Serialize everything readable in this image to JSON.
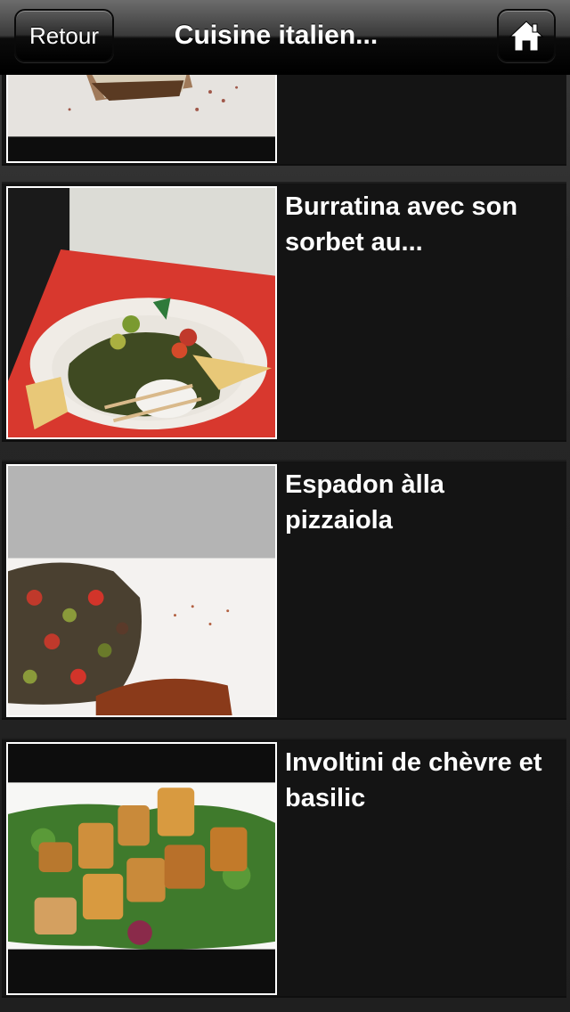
{
  "navbar": {
    "back_label": "Retour",
    "title": "Cuisine italien..."
  },
  "items": [
    {
      "title": "",
      "photo": "tiramisu-dessert-photo"
    },
    {
      "title": "Burratina avec son sorbet au...",
      "photo": "burratina-salad-photo"
    },
    {
      "title": "Espadon àlla pizzaiola",
      "photo": "swordfish-vegetables-photo"
    },
    {
      "title": "Involtini de chèvre et basilic",
      "photo": "goat-cheese-rolls-salad-photo"
    }
  ],
  "colors": {
    "background": "#141414",
    "text": "#ffffff",
    "thumb_border": "#ffffff"
  }
}
